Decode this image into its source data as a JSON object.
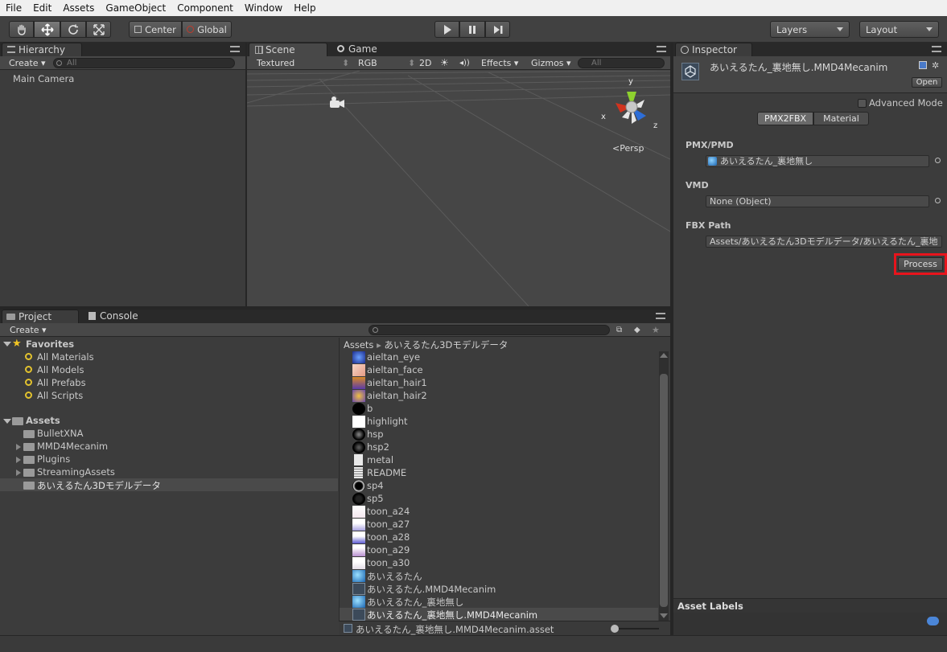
{
  "menu": [
    "File",
    "Edit",
    "Assets",
    "GameObject",
    "Component",
    "Window",
    "Help"
  ],
  "toolbar": {
    "center": "Center",
    "global": "Global",
    "layers": "Layers",
    "layout": "Layout"
  },
  "hierarchy": {
    "tab": "Hierarchy",
    "create": "Create",
    "search_placeholder": "All",
    "items": [
      "Main Camera"
    ]
  },
  "scene": {
    "tab_scene": "Scene",
    "tab_game": "Game",
    "shading": "Textured",
    "render": "RGB",
    "mode2d": "2D",
    "effects": "Effects",
    "gizmos": "Gizmos",
    "search_placeholder": "All",
    "axis_x": "x",
    "axis_y": "y",
    "axis_z": "z",
    "persp": "Persp"
  },
  "inspector": {
    "tab": "Inspector",
    "title": "あいえるたん_裏地無し.MMD4Mecanim",
    "open": "Open",
    "advanced_mode": "Advanced Mode",
    "tabs": [
      "PMX2FBX",
      "Material"
    ],
    "pmx_label": "PMX/PMD",
    "pmx_value": "あいえるたん_裏地無し",
    "vmd_label": "VMD",
    "vmd_value": "None (Object)",
    "fbx_label": "FBX Path",
    "fbx_value": "Assets/あいえるたん3Dモデルデータ/あいえるたん_裏地",
    "process": "Process",
    "asset_labels": "Asset Labels",
    "highlight_color": "#e8141c"
  },
  "project": {
    "tab_project": "Project",
    "tab_console": "Console",
    "create": "Create",
    "favorites_label": "Favorites",
    "favorites": [
      "All Materials",
      "All Models",
      "All Prefabs",
      "All Scripts"
    ],
    "assets_label": "Assets",
    "folders": [
      "BulletXNA",
      "MMD4Mecanim",
      "Plugins",
      "StreamingAssets",
      "あいえるたん3Dモデルデータ"
    ],
    "breadcrumb_root": "Assets",
    "breadcrumb_folder": "あいえるたん3Dモデルデータ",
    "files": [
      "aieltan_eye",
      "aieltan_face",
      "aieltan_hair1",
      "aieltan_hair2",
      "b",
      "highlight",
      "hsp",
      "hsp2",
      "metal",
      "README",
      "sp4",
      "sp5",
      "toon_a24",
      "toon_a27",
      "toon_a28",
      "toon_a29",
      "toon_a30",
      "あいえるたん",
      "あいえるたん.MMD4Mecanim",
      "あいえるたん_裏地無し",
      "あいえるたん_裏地無し.MMD4Mecanim"
    ],
    "status_file": "あいえるたん_裏地無し.MMD4Mecanim.asset"
  }
}
